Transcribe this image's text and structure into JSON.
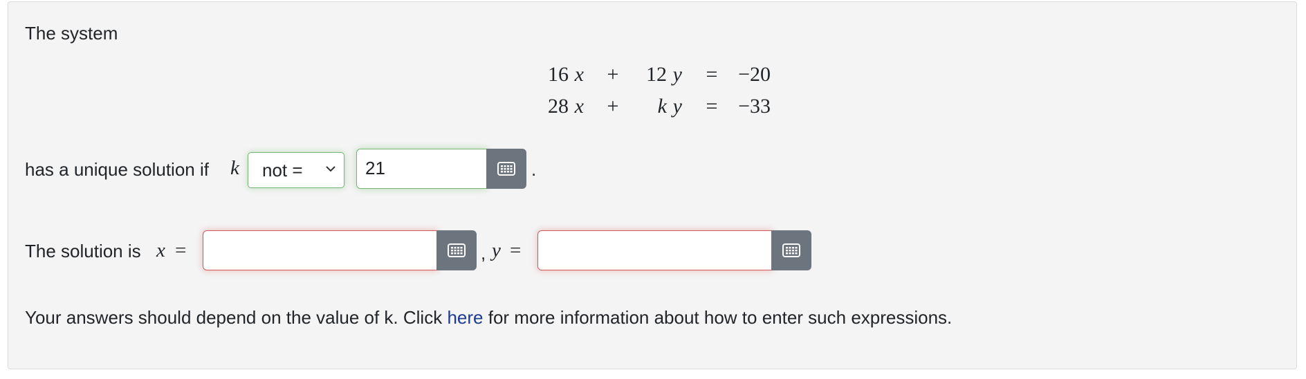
{
  "intro": "The system",
  "system": {
    "rows": [
      {
        "c1": "16",
        "v1": "x",
        "op": "+",
        "c2": "12",
        "v2": "y",
        "eq": "=",
        "rhs": "−20"
      },
      {
        "c1": "28",
        "v1": "x",
        "op": "+",
        "c2": "k",
        "v2": "y",
        "eq": "=",
        "rhs": "−33"
      }
    ]
  },
  "condition": {
    "prefix": "has a unique solution if",
    "variable": "k",
    "select_value": "not =",
    "input_value": "21",
    "suffix": "."
  },
  "solution": {
    "prefix": "The solution is",
    "x_label": "x",
    "equals": "=",
    "comma": ",",
    "y_label": "y",
    "x_value": "",
    "y_value": ""
  },
  "footer": {
    "before": "Your answers should depend on the value of k. Click",
    "link": "here",
    "after": "for more information about how to enter such expressions."
  },
  "colors": {
    "valid_border": "#74b474",
    "invalid_border": "#cf5a5a",
    "keypad_button": "#6c757d",
    "link": "#1f3b8f"
  },
  "icons": {
    "keypad": "keyboard-grid-icon",
    "dropdown": "chevron-down-icon"
  }
}
